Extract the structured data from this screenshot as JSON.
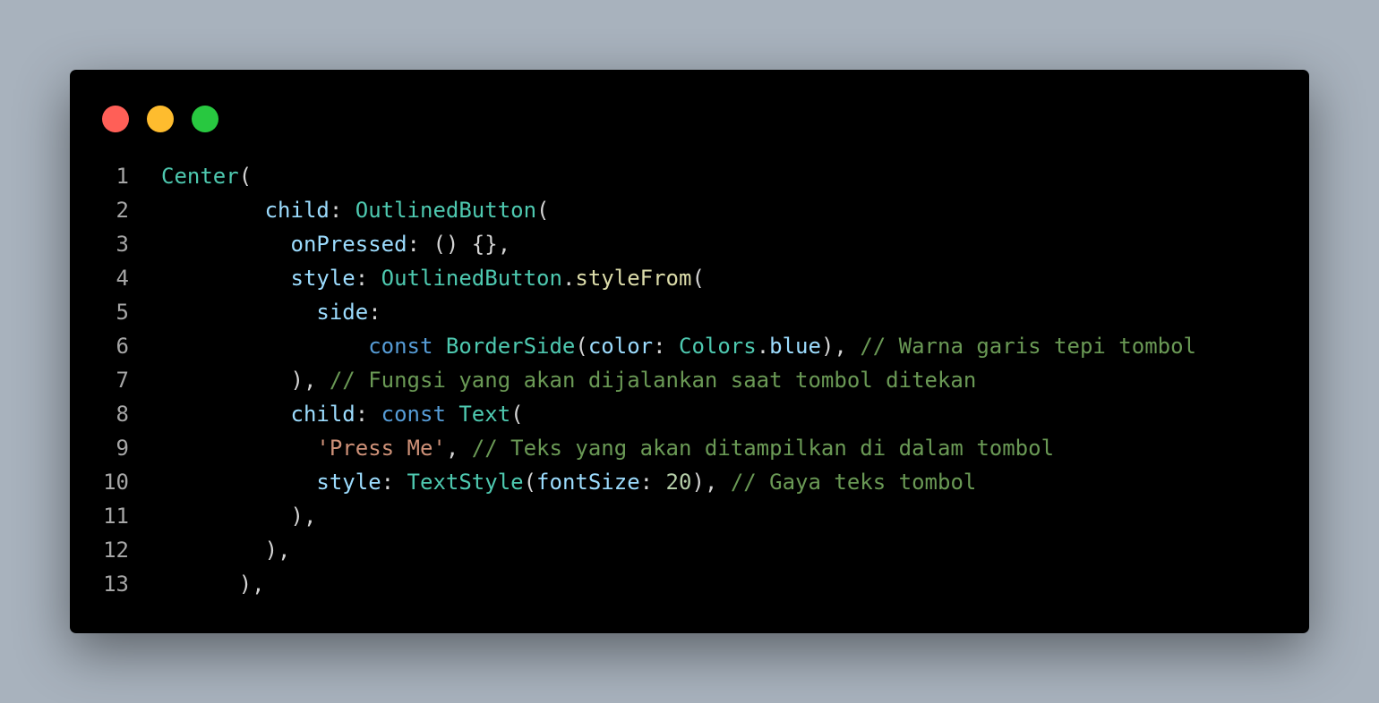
{
  "window": {
    "dots": [
      {
        "name": "close-dot",
        "color": "#ff5f57"
      },
      {
        "name": "minimize-dot",
        "color": "#febc2e"
      },
      {
        "name": "maximize-dot",
        "color": "#28c840"
      }
    ]
  },
  "colors": {
    "type": "#4ec9b0",
    "prop": "#9cdcfe",
    "punc": "#d4d4d4",
    "func": "#dcdcaa",
    "kw": "#569cd6",
    "str": "#ce9178",
    "num": "#b5cea8",
    "comment": "#6a9955"
  },
  "lines": [
    {
      "n": "1",
      "tokens": [
        [
          "Center",
          "type"
        ],
        [
          "(",
          "punc"
        ]
      ]
    },
    {
      "n": "2",
      "tokens": [
        [
          "        ",
          "punc"
        ],
        [
          "child",
          "prop"
        ],
        [
          ": ",
          "punc"
        ],
        [
          "OutlinedButton",
          "type"
        ],
        [
          "(",
          "punc"
        ]
      ]
    },
    {
      "n": "3",
      "tokens": [
        [
          "          ",
          "punc"
        ],
        [
          "onPressed",
          "prop"
        ],
        [
          ": () {},",
          "punc"
        ]
      ]
    },
    {
      "n": "4",
      "tokens": [
        [
          "          ",
          "punc"
        ],
        [
          "style",
          "prop"
        ],
        [
          ": ",
          "punc"
        ],
        [
          "OutlinedButton",
          "type"
        ],
        [
          ".",
          "punc"
        ],
        [
          "styleFrom",
          "func"
        ],
        [
          "(",
          "punc"
        ]
      ]
    },
    {
      "n": "5",
      "tokens": [
        [
          "            ",
          "punc"
        ],
        [
          "side",
          "prop"
        ],
        [
          ":",
          "punc"
        ]
      ]
    },
    {
      "n": "6",
      "tokens": [
        [
          "                ",
          "punc"
        ],
        [
          "const ",
          "kw"
        ],
        [
          "BorderSide",
          "type"
        ],
        [
          "(",
          "punc"
        ],
        [
          "color",
          "prop"
        ],
        [
          ": ",
          "punc"
        ],
        [
          "Colors",
          "type"
        ],
        [
          ".",
          "punc"
        ],
        [
          "blue",
          "prop"
        ],
        [
          "), ",
          "punc"
        ],
        [
          "// Warna garis tepi tombol",
          "comment"
        ]
      ]
    },
    {
      "n": "7",
      "tokens": [
        [
          "          ",
          "punc"
        ],
        [
          "), ",
          "punc"
        ],
        [
          "// Fungsi yang akan dijalankan saat tombol ditekan",
          "comment"
        ]
      ]
    },
    {
      "n": "8",
      "tokens": [
        [
          "          ",
          "punc"
        ],
        [
          "child",
          "prop"
        ],
        [
          ": ",
          "punc"
        ],
        [
          "const ",
          "kw"
        ],
        [
          "Text",
          "type"
        ],
        [
          "(",
          "punc"
        ]
      ]
    },
    {
      "n": "9",
      "tokens": [
        [
          "            ",
          "punc"
        ],
        [
          "'Press Me'",
          "str"
        ],
        [
          ", ",
          "punc"
        ],
        [
          "// Teks yang akan ditampilkan di dalam tombol",
          "comment"
        ]
      ]
    },
    {
      "n": "10",
      "tokens": [
        [
          "            ",
          "punc"
        ],
        [
          "style",
          "prop"
        ],
        [
          ": ",
          "punc"
        ],
        [
          "TextStyle",
          "type"
        ],
        [
          "(",
          "punc"
        ],
        [
          "fontSize",
          "prop"
        ],
        [
          ": ",
          "punc"
        ],
        [
          "20",
          "num"
        ],
        [
          "), ",
          "punc"
        ],
        [
          "// Gaya teks tombol",
          "comment"
        ]
      ]
    },
    {
      "n": "11",
      "tokens": [
        [
          "          ",
          "punc"
        ],
        [
          "),",
          "punc"
        ]
      ]
    },
    {
      "n": "12",
      "tokens": [
        [
          "        ",
          "punc"
        ],
        [
          "),",
          "punc"
        ]
      ]
    },
    {
      "n": "13",
      "tokens": [
        [
          "      ",
          "punc"
        ],
        [
          "),",
          "punc"
        ]
      ]
    }
  ]
}
